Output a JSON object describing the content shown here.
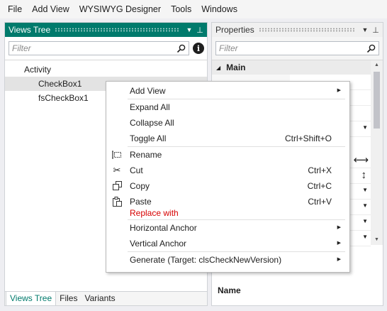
{
  "menubar": {
    "items": [
      "File",
      "Add View",
      "WYSIWYG Designer",
      "Tools",
      "Windows"
    ]
  },
  "views_tree": {
    "title": "Views Tree",
    "search_placeholder": "Filter",
    "items": [
      {
        "label": "Activity",
        "level": 0
      },
      {
        "label": "CheckBox1",
        "level": 1,
        "selected": true
      },
      {
        "label": "fsCheckBox1",
        "level": 1
      }
    ],
    "bottom_tabs": [
      "Views Tree",
      "Files",
      "Variants"
    ]
  },
  "properties": {
    "title": "Properties",
    "search_placeholder": "Filter",
    "group": "Main",
    "desc_title": "Name"
  },
  "context_menu": {
    "items": [
      {
        "label": "Add View",
        "submenu": true
      },
      {
        "label": "Expand All"
      },
      {
        "label": "Collapse All"
      },
      {
        "label": "Toggle All",
        "shortcut": "Ctrl+Shift+O"
      },
      {
        "label": "Rename",
        "icon": "rename-icon"
      },
      {
        "label": "Cut",
        "shortcut": "Ctrl+X",
        "icon": "scissors-icon"
      },
      {
        "label": "Copy",
        "shortcut": "Ctrl+C",
        "icon": "copy-icon"
      },
      {
        "label": "Paste",
        "shortcut": "Ctrl+V",
        "icon": "paste-icon"
      },
      {
        "label": "Horizontal Anchor",
        "submenu": true
      },
      {
        "label": "Vertical Anchor",
        "submenu": true
      },
      {
        "label": "Generate (Target: clsCheckNewVersion)",
        "submenu": true
      }
    ],
    "paste_replace_label": "Replace with"
  },
  "colors": {
    "accent": "#007a6c",
    "warning_text": "#d60000"
  }
}
